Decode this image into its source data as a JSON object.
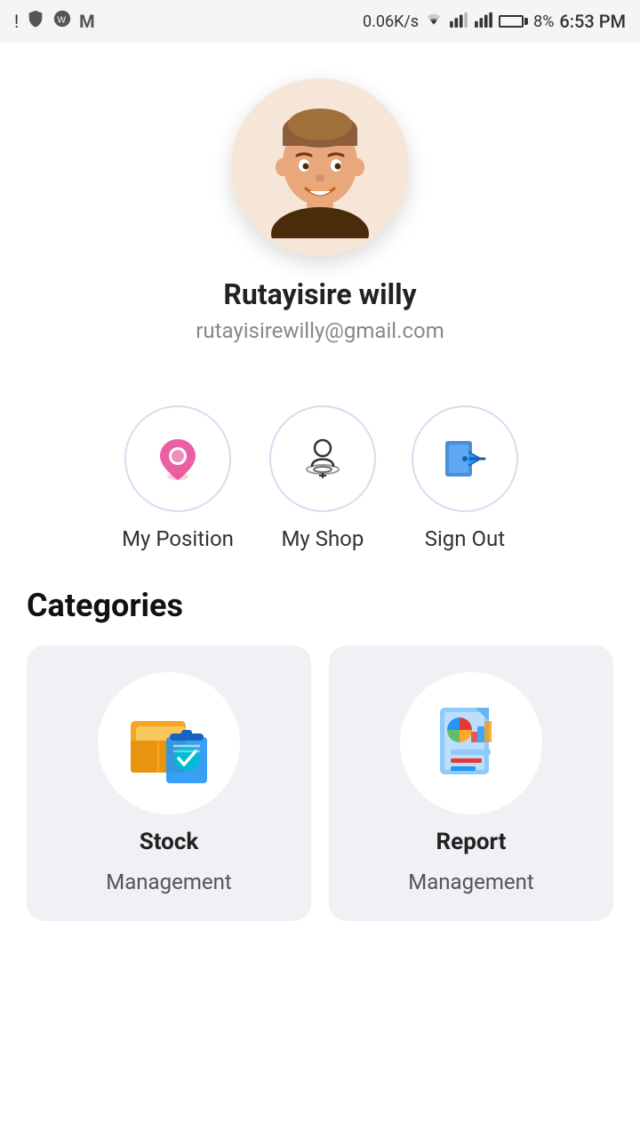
{
  "statusBar": {
    "speed": "0.06K/s",
    "battery": "8%",
    "time": "6:53 PM"
  },
  "profile": {
    "name": "Rutayisire willy",
    "email": "rutayisirewilly@gmail.com"
  },
  "actions": [
    {
      "id": "my-position",
      "label": "My Position"
    },
    {
      "id": "my-shop",
      "label": "My Shop"
    },
    {
      "id": "sign-out",
      "label": "Sign Out"
    }
  ],
  "categories": {
    "title": "Categories",
    "items": [
      {
        "id": "stock",
        "name": "Stock",
        "sub": "Management"
      },
      {
        "id": "report",
        "name": "Report",
        "sub": "Management"
      }
    ]
  }
}
